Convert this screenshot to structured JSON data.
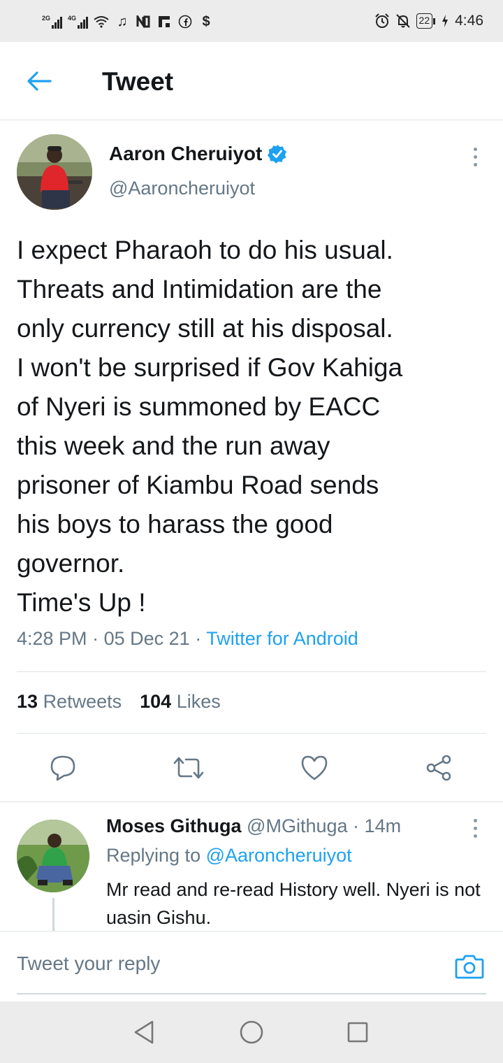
{
  "status_bar": {
    "sim1_label": "2G",
    "sim2_label": "4G",
    "battery": "22",
    "time": "4:46",
    "icons": [
      "signal-icon",
      "wifi-icon",
      "music-icon",
      "n-icon",
      "flipboard-icon",
      "facebook-icon",
      "dollar-icon",
      "alarm-icon",
      "mute-icon",
      "battery-icon",
      "charging-icon"
    ]
  },
  "header": {
    "title": "Tweet"
  },
  "tweet": {
    "author_name": "Aaron Cheruiyot",
    "author_handle": "@Aaroncheruiyot",
    "text": "I expect Pharaoh to do his usual.\nThreats and Intimidation are the\nonly currency still at his disposal.\nI won't be surprised if Gov Kahiga\nof Nyeri is summoned by EACC\nthis week and the run away\nprisoner of Kiambu Road sends\nhis boys to harass the good\ngovernor.\nTime's Up !",
    "time": "4:28 PM",
    "date": "05 Dec 21",
    "source": "Twitter for Android",
    "retweets_count": "13",
    "retweets_label": "Retweets",
    "likes_count": "104",
    "likes_label": "Likes"
  },
  "reply": {
    "author_name": "Moses Githuga",
    "author_handle": "@MGithuga",
    "age": "14m",
    "replying_label": "Replying to",
    "replying_handle": "@Aaroncheruiyot",
    "text": "Mr read and re-read History well. Nyeri is not uasin Gishu."
  },
  "compose": {
    "placeholder": "Tweet your reply"
  },
  "colors": {
    "accent": "#1da1f2",
    "muted": "#657786",
    "text": "#14171a",
    "divider": "#dfe3e6"
  }
}
